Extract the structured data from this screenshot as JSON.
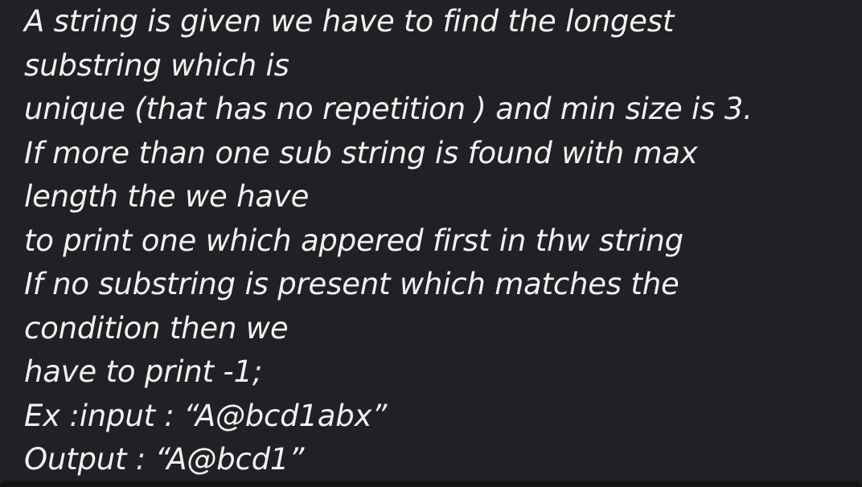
{
  "message": {
    "lines": [
      "A string is given we have to find the longest",
      "substring which is",
      "unique (that has no repetition ) and min size is 3.",
      "If more than one sub string is found with max",
      "length the we have",
      "to print one which appered first in thw string",
      "If no substring is present which matches the",
      "condition then we",
      "have to print -1;",
      "Ex :input : “A@bcd1abx”",
      "Output : “A@bcd1”"
    ]
  },
  "colors": {
    "background": "#202124",
    "text": "#f2f2f2",
    "bottom_bar": "#141414"
  }
}
